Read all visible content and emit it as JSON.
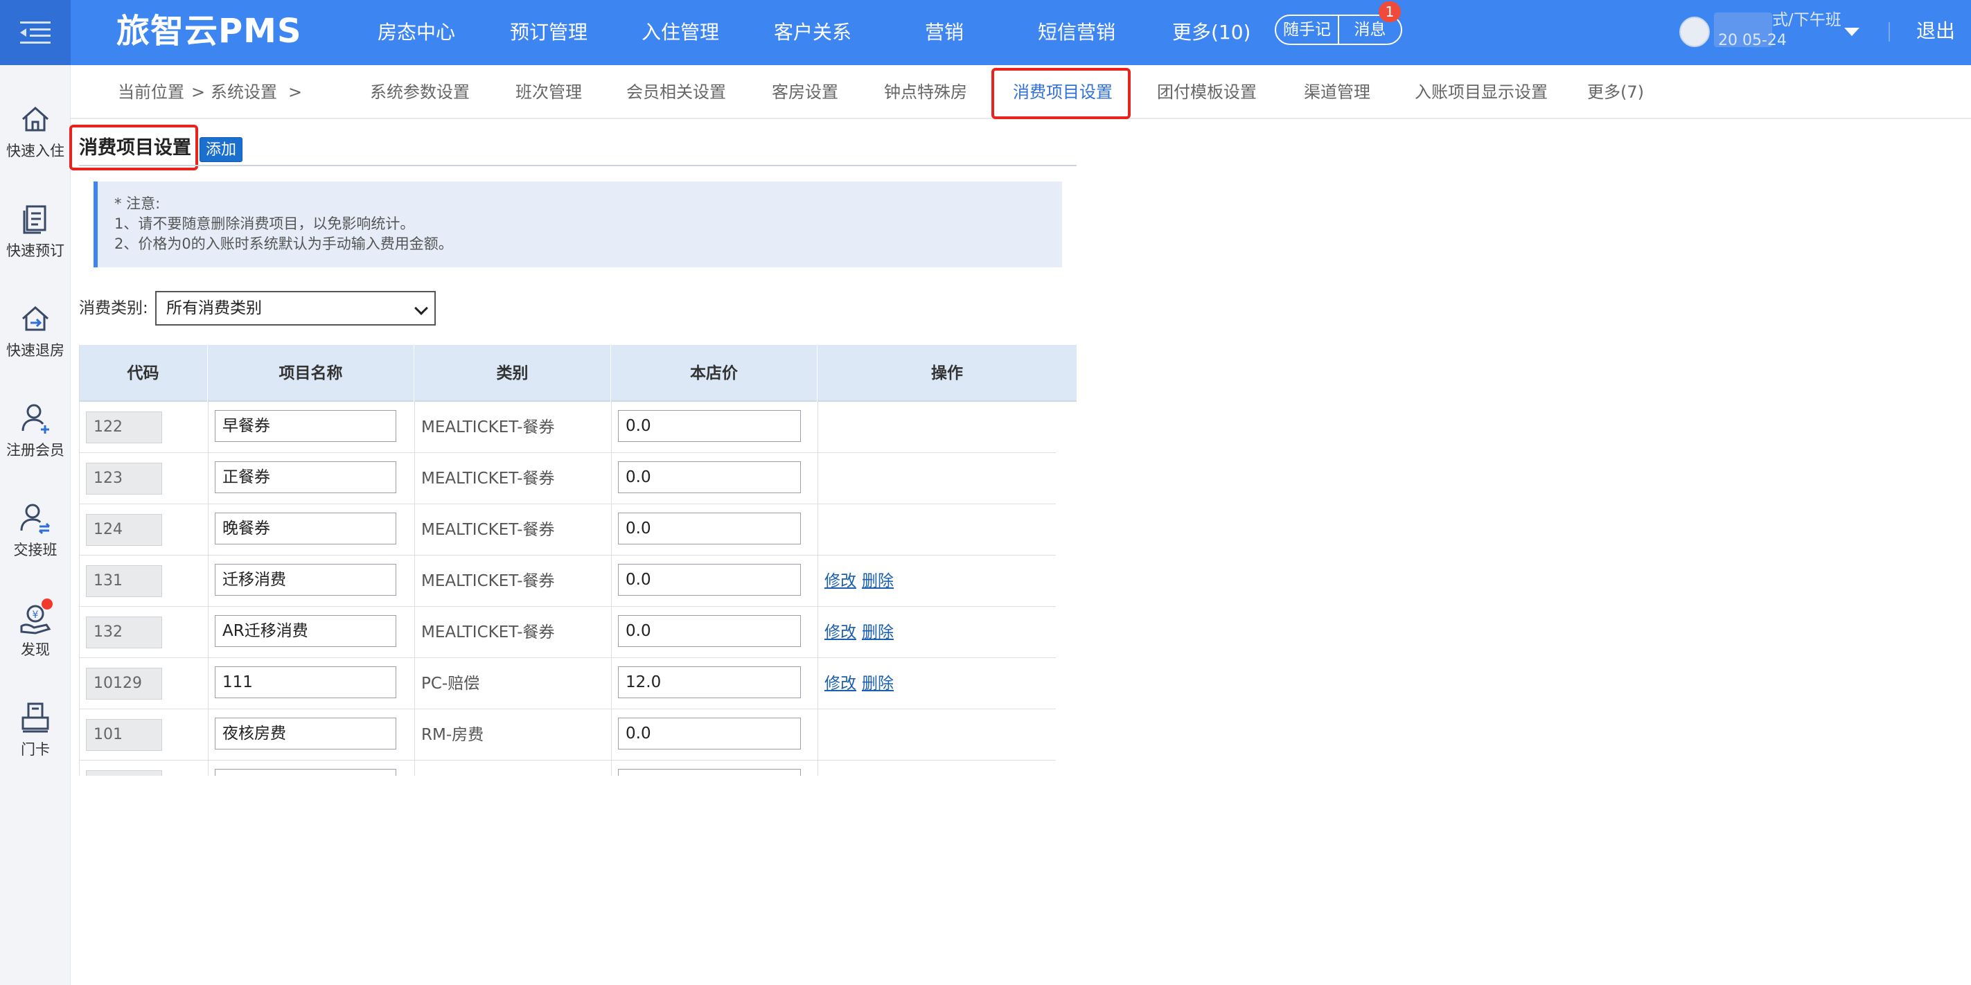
{
  "app": {
    "brand": "旅智云PMS"
  },
  "topnav": {
    "items": [
      "房态中心",
      "预订管理",
      "入住管理",
      "客户关系",
      "营销",
      "短信营销",
      "更多(10)"
    ],
    "notes_label": "随手记",
    "messages_label": "消息",
    "messages_badge": "1",
    "user_text": "式/下午班",
    "user_date": "20  05-24",
    "logout": "退出"
  },
  "sidebar": {
    "items": [
      {
        "label": "快速入住",
        "icon": "home-icon"
      },
      {
        "label": "快速预订",
        "icon": "book-icon"
      },
      {
        "label": "快速退房",
        "icon": "checkout-icon"
      },
      {
        "label": "注册会员",
        "icon": "add-user-icon"
      },
      {
        "label": "交接班",
        "icon": "shift-swap-icon"
      },
      {
        "label": "发现",
        "icon": "discover-icon"
      },
      {
        "label": "门卡",
        "icon": "card-icon"
      }
    ]
  },
  "breadcrumb": {
    "current_label": "当前位置",
    "sep1": ">",
    "section": "系统设置",
    "sep2": ">"
  },
  "subtabs": {
    "items": [
      "系统参数设置",
      "班次管理",
      "会员相关设置",
      "客房设置",
      "钟点特殊房",
      "消费项目设置",
      "团付模板设置",
      "渠道管理",
      "入账项目显示设置",
      "更多(7)"
    ],
    "active": "消费项目设置"
  },
  "page": {
    "title": "消费项目设置",
    "add_button": "添加",
    "notice": {
      "line1": "* 注意:",
      "line2": "1、请不要随意删除消费项目，以免影响统计。",
      "line3": "2、价格为0的入账时系统默认为手动输入费用金额。"
    },
    "filter_label": "消费类别:",
    "filter_value": "所有消费类别"
  },
  "table": {
    "columns": [
      "代码",
      "项目名称",
      "类别",
      "本店价",
      "操作"
    ],
    "edit_label": "修改",
    "delete_label": "删除",
    "rows": [
      {
        "code": "122",
        "name": "早餐券",
        "category": "MEALTICKET-餐券",
        "price": "0.0",
        "ops": false
      },
      {
        "code": "123",
        "name": "正餐券",
        "category": "MEALTICKET-餐券",
        "price": "0.0",
        "ops": false
      },
      {
        "code": "124",
        "name": "晚餐券",
        "category": "MEALTICKET-餐券",
        "price": "0.0",
        "ops": false
      },
      {
        "code": "131",
        "name": "迁移消费",
        "category": "MEALTICKET-餐券",
        "price": "0.0",
        "ops": true
      },
      {
        "code": "132",
        "name": "AR迁移消费",
        "category": "MEALTICKET-餐券",
        "price": "0.0",
        "ops": true
      },
      {
        "code": "10129",
        "name": "111",
        "category": "PC-赔偿",
        "price": "12.0",
        "ops": true
      },
      {
        "code": "101",
        "name": "夜核房费",
        "category": "RM-房费",
        "price": "0.0",
        "ops": false
      },
      {
        "code": "",
        "name": "",
        "category": "",
        "price": "",
        "ops": false
      }
    ]
  },
  "colors": {
    "primary": "#3d85f0",
    "highlight": "#e8231e",
    "link": "#1b5fb0"
  }
}
